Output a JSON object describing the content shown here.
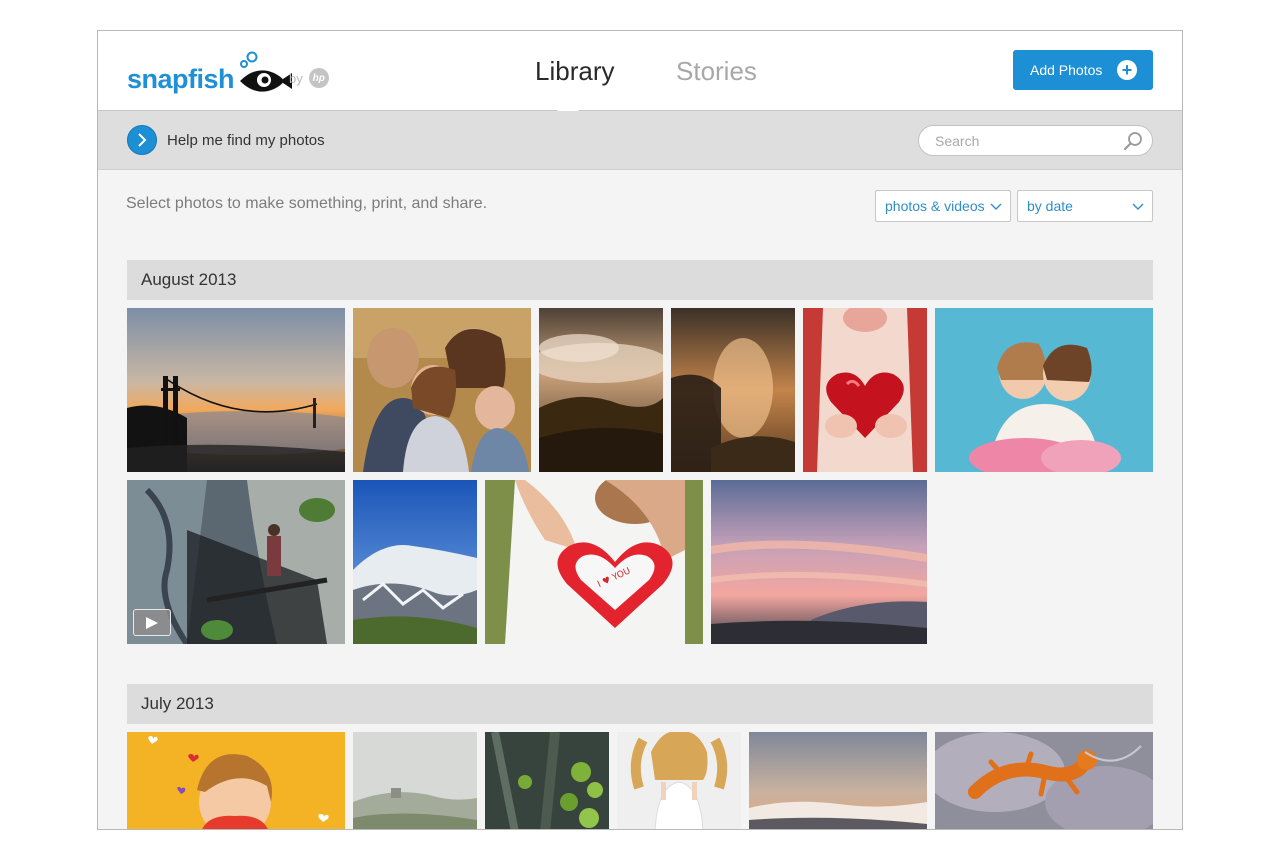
{
  "header": {
    "logo_text": "snapfish",
    "by_label": "by",
    "hp_label": "hp",
    "tabs": [
      {
        "label": "Library",
        "active": true
      },
      {
        "label": "Stories",
        "active": false
      }
    ],
    "add_photos_label": "Add Photos"
  },
  "search_bar": {
    "help_label": "Help me find my photos",
    "search_placeholder": "Search"
  },
  "toolbar": {
    "subtitle": "Select photos to make something, print, and share.",
    "filter_type": "photos & videos",
    "sort_order": "by date"
  },
  "colors": {
    "accent": "#1d8fd5",
    "month_header_bg": "#dcdcdc",
    "canvas_bg": "#f4f4f4"
  },
  "sections": [
    {
      "month": "August 2013",
      "photos": [
        {
          "subject": "golden-gate-sunset"
        },
        {
          "subject": "family-portrait"
        },
        {
          "subject": "clouds-over-hills"
        },
        {
          "subject": "foggy-sunrise"
        },
        {
          "subject": "red-glitter-heart"
        },
        {
          "subject": "two-girls-hugging"
        },
        {
          "subject": "mountain-stairs",
          "video": true
        },
        {
          "subject": "snowy-mountain"
        },
        {
          "subject": "i-love-you-daddy-heart"
        },
        {
          "subject": "pink-sunset-city"
        }
      ]
    },
    {
      "month": "July 2013",
      "photos": [
        {
          "subject": "girl-with-hearts"
        },
        {
          "subject": "misty-hillside"
        },
        {
          "subject": "green-vine-wall"
        },
        {
          "subject": "girl-white-dress"
        },
        {
          "subject": "clouds-at-dusk"
        },
        {
          "subject": "orange-salamander"
        }
      ]
    }
  ]
}
